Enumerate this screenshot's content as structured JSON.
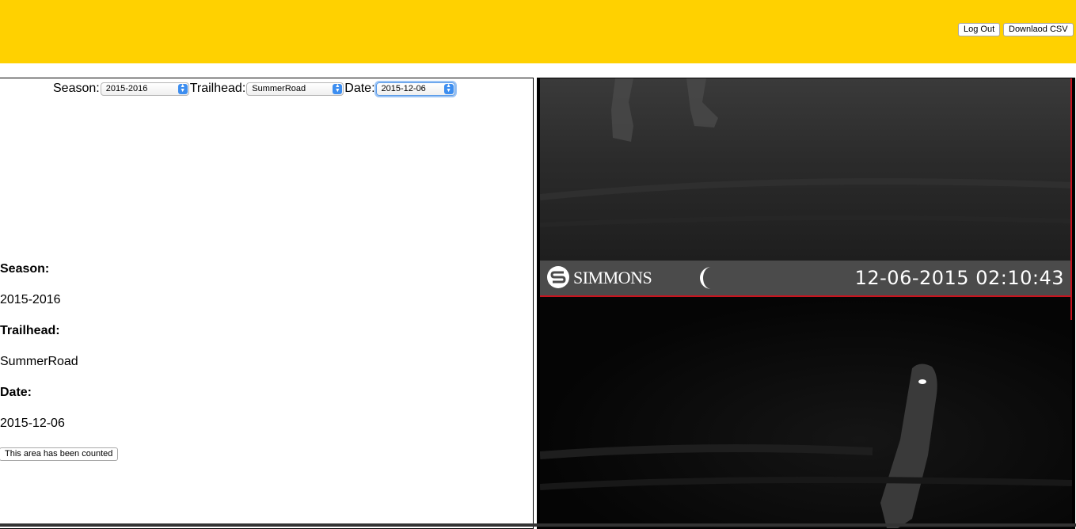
{
  "header": {
    "background": "#FFD100",
    "logout_label": "Log Out",
    "download_label": "Downlaod CSV"
  },
  "filters": {
    "season_label": "Season:",
    "season_value": "2015-2016",
    "trailhead_label": "Trailhead:",
    "trailhead_value": "SummerRoad",
    "date_label": "Date:",
    "date_value": "2015-12-06"
  },
  "info": {
    "season_label": "Season:",
    "season_value": "2015-2016",
    "trailhead_label": "Trailhead:",
    "trailhead_value": "SummerRoad",
    "date_label": "Date:",
    "date_value": "2015-12-06"
  },
  "count_button_label": "This area has been counted",
  "camera": {
    "brand": "SIMMONS",
    "timestamp": "12-06-2015 02:10:43",
    "band_color": "#4B4B4B",
    "divider_color": "#C8141E"
  }
}
